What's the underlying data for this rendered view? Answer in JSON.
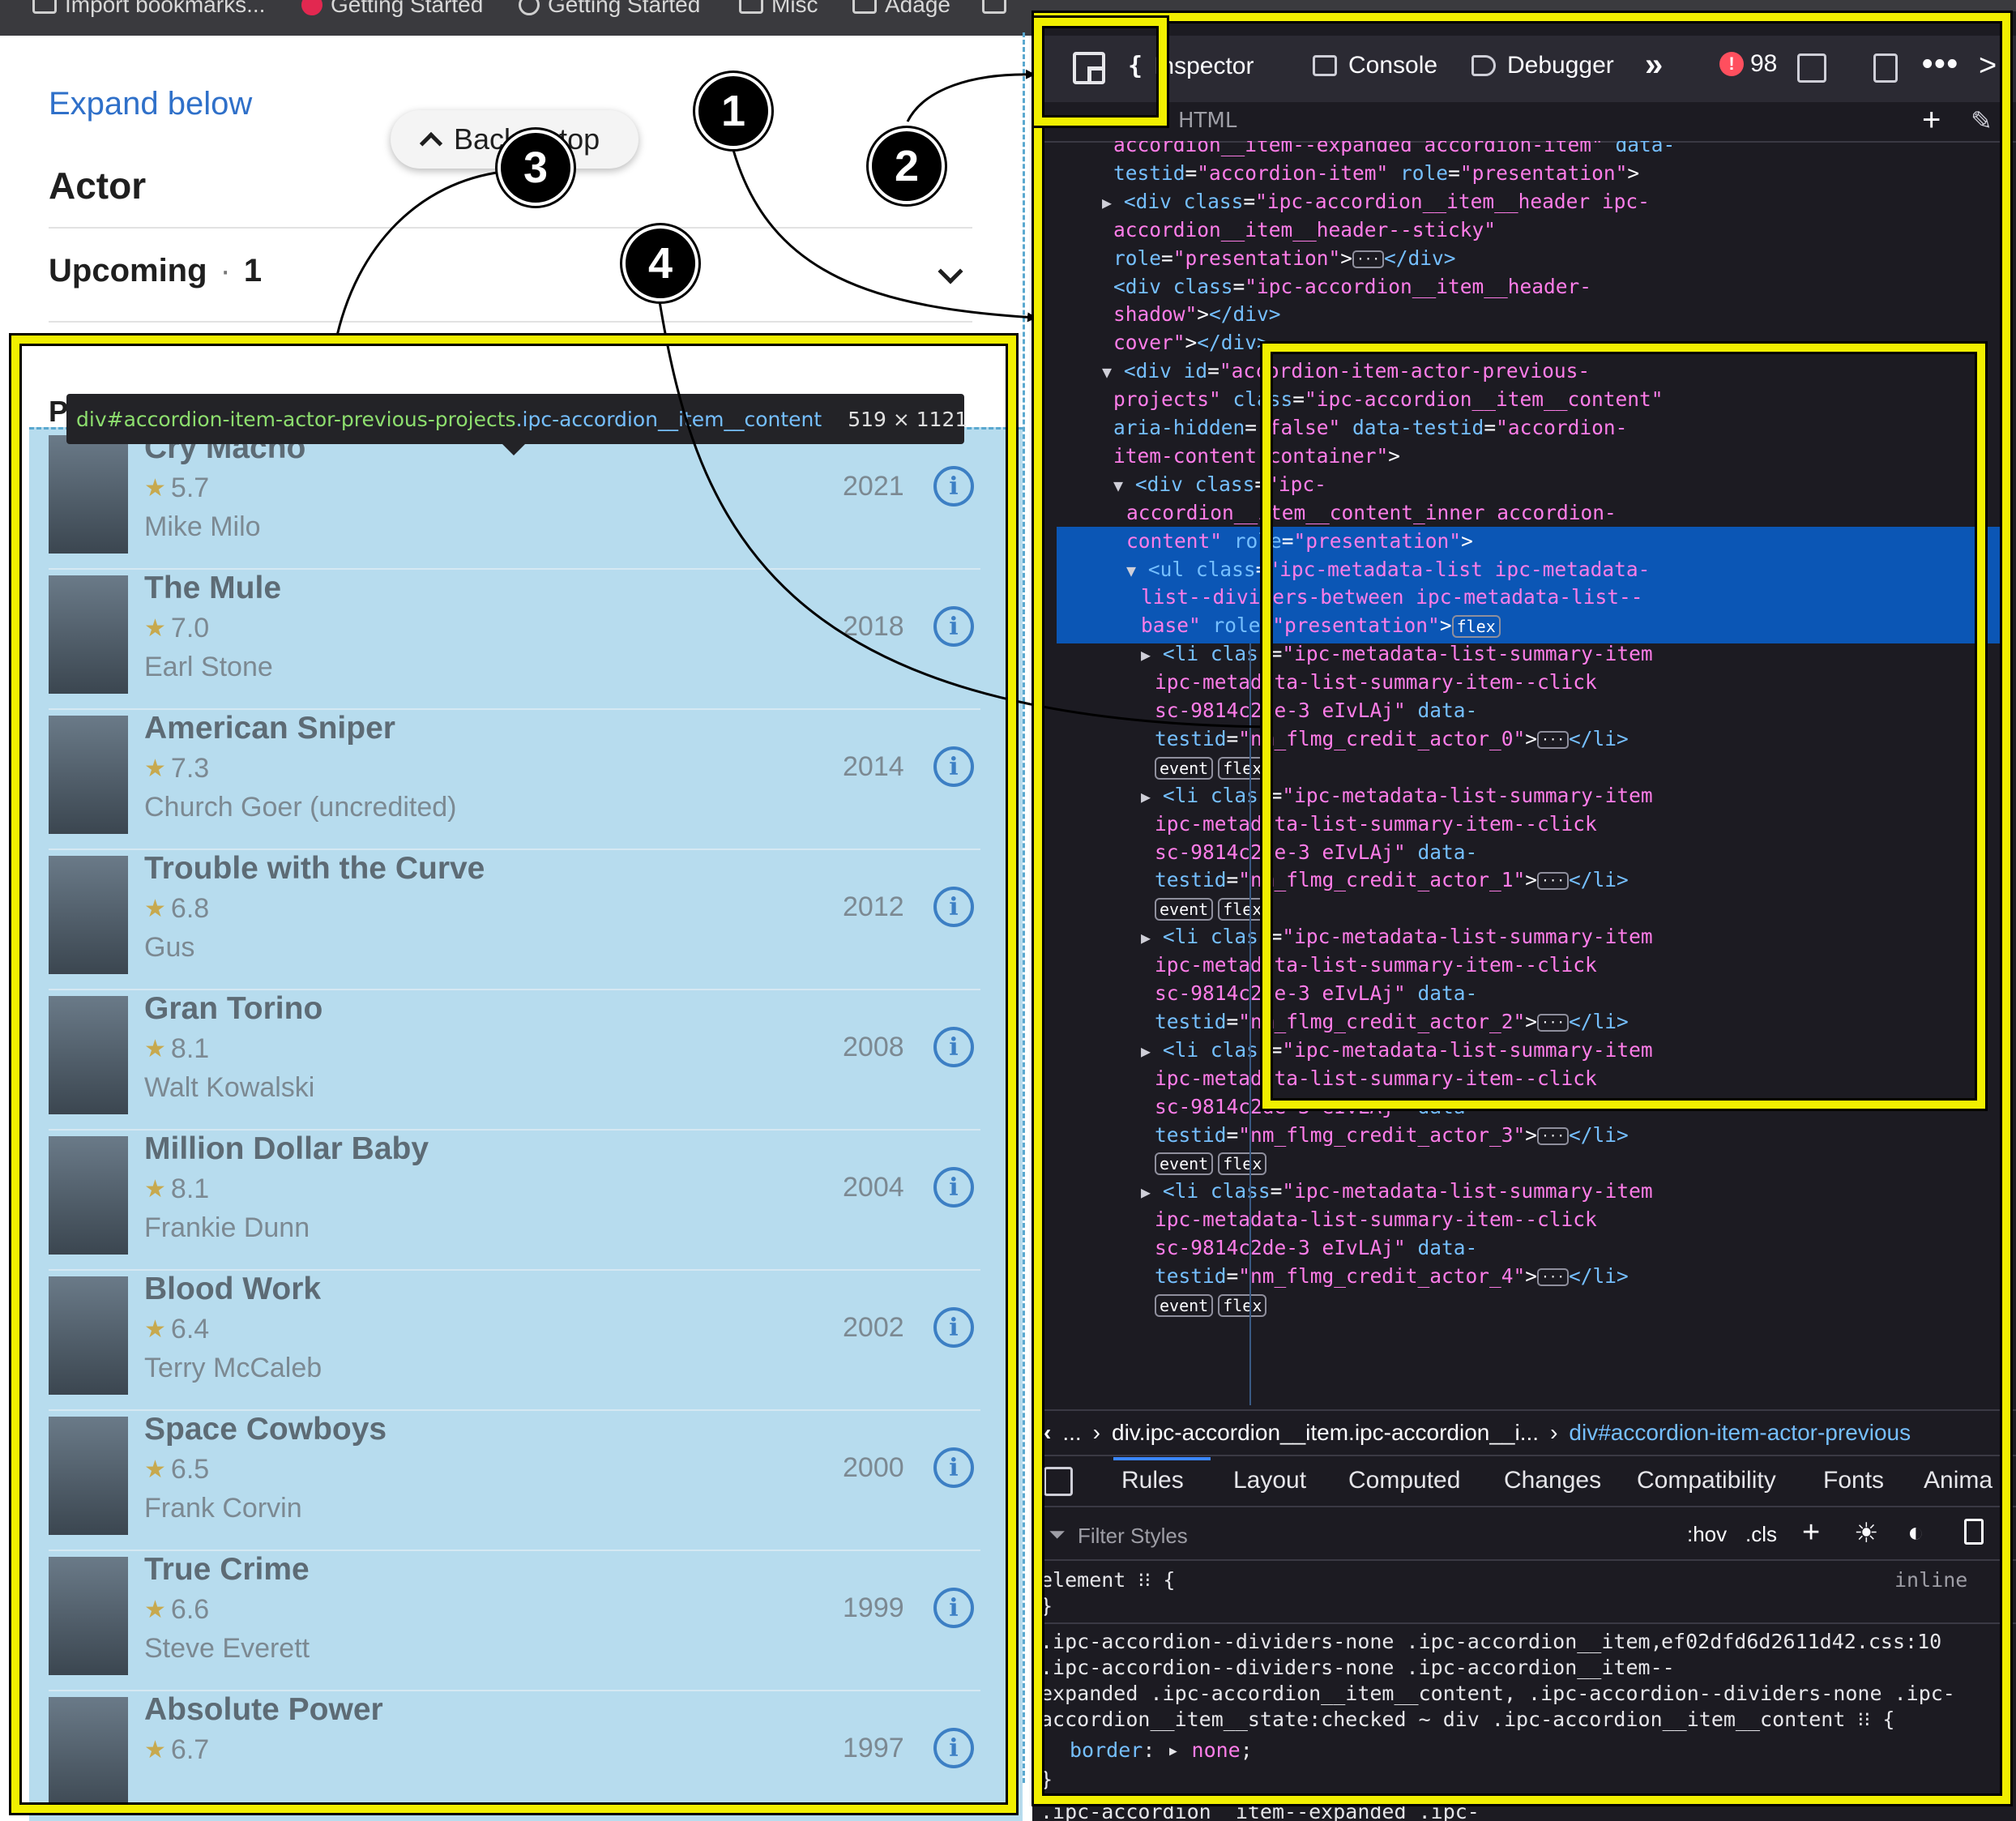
{
  "bookmarks": [
    "Import bookmarks...",
    "Getting Started",
    "Getting Started",
    "Misc",
    "Adage",
    ""
  ],
  "page": {
    "expand_link": "Expand below",
    "section_title": "Actor",
    "back_to_top": "Back to top",
    "upcoming_label": "Upcoming",
    "upcoming_dot": "·",
    "upcoming_count": "1",
    "previous_letter": "P",
    "tooltip": {
      "tag": "div",
      "selector_id": "#accordion-item-actor-previous-projects",
      "selector_class": ".ipc-accordion__item__content",
      "dims": "519 × 1121"
    },
    "movies": [
      {
        "title": "Cry Macho",
        "rating": "5.7",
        "role": "Mike Milo",
        "year": "2021"
      },
      {
        "title": "The Mule",
        "rating": "7.0",
        "role": "Earl Stone",
        "year": "2018"
      },
      {
        "title": "American Sniper",
        "rating": "7.3",
        "role": "Church Goer (uncredited)",
        "year": "2014"
      },
      {
        "title": "Trouble with the Curve",
        "rating": "6.8",
        "role": "Gus",
        "year": "2012"
      },
      {
        "title": "Gran Torino",
        "rating": "8.1",
        "role": "Walt Kowalski",
        "year": "2008"
      },
      {
        "title": "Million Dollar Baby",
        "rating": "8.1",
        "role": "Frankie Dunn",
        "year": "2004"
      },
      {
        "title": "Blood Work",
        "rating": "6.4",
        "role": "Terry McCaleb",
        "year": "2002"
      },
      {
        "title": "Space Cowboys",
        "rating": "6.5",
        "role": "Frank Corvin",
        "year": "2000"
      },
      {
        "title": "True Crime",
        "rating": "6.6",
        "role": "Steve Everett",
        "year": "1999"
      },
      {
        "title": "Absolute Power",
        "rating": "6.7",
        "role": "",
        "year": "1997"
      }
    ],
    "info_glyph": "i",
    "star_glyph": "★"
  },
  "devtools": {
    "tabs": {
      "inspector": "Inspector",
      "console": "Console",
      "debugger": "Debugger"
    },
    "error_count": "98",
    "error_glyph": "!",
    "html_label": "HTML",
    "add_glyph": "+",
    "more_glyph": "»",
    "dots_glyph": "•••",
    "chevron_right": ">",
    "code_lines": [
      {
        "ind": 0,
        "parts": [
          [
            "v",
            "accordion__item--expanded accordion-item\""
          ],
          [
            "a",
            " data-"
          ]
        ]
      },
      {
        "ind": 0,
        "parts": [
          [
            "a",
            "testid"
          ],
          [
            "p",
            "="
          ],
          [
            "v",
            "\"accordion-item\""
          ],
          [
            "a",
            " role"
          ],
          [
            "p",
            "="
          ],
          [
            "v",
            "\"presentation\""
          ],
          [
            "p",
            ">"
          ]
        ]
      },
      {
        "ind": 0,
        "tri": "▶",
        "parts": [
          [
            "t",
            "<div"
          ],
          [
            "a",
            " class"
          ],
          [
            "p",
            "="
          ],
          [
            "v",
            "\"ipc-accordion__item__header ipc-"
          ]
        ]
      },
      {
        "ind": 1,
        "parts": [
          [
            "v",
            "accordion__item__header--sticky\""
          ]
        ]
      },
      {
        "ind": 1,
        "parts": [
          [
            "a",
            "role"
          ],
          [
            "p",
            "="
          ],
          [
            "v",
            "\"presentation\""
          ],
          [
            "p",
            ">"
          ],
          [
            "ell",
            "···"
          ],
          [
            "t",
            "</div>"
          ]
        ]
      },
      {
        "ind": 1,
        "parts": [
          [
            "t",
            "<div"
          ],
          [
            "a",
            " class"
          ],
          [
            "p",
            "="
          ],
          [
            "v",
            "\"ipc-accordion__item__header-"
          ]
        ]
      },
      {
        "ind": 1,
        "parts": [
          [
            "v",
            "shadow\""
          ],
          [
            "p",
            ">"
          ],
          [
            "t",
            "</div>"
          ]
        ]
      },
      {
        "ind": 1,
        "parts": [
          [
            "v",
            "cover\""
          ],
          [
            "p",
            ">"
          ],
          [
            "t",
            "</div>"
          ]
        ]
      },
      {
        "ind": 0,
        "tri": "▼",
        "parts": [
          [
            "t",
            "<div"
          ],
          [
            "a",
            " id"
          ],
          [
            "p",
            "="
          ],
          [
            "v",
            "\"accordion-item-actor-previous-"
          ]
        ]
      },
      {
        "ind": 1,
        "parts": [
          [
            "v",
            "projects\""
          ],
          [
            "a",
            " class"
          ],
          [
            "p",
            "="
          ],
          [
            "v",
            "\"ipc-accordion__item__content\""
          ]
        ]
      },
      {
        "ind": 1,
        "parts": [
          [
            "a",
            "aria-hidden"
          ],
          [
            "p",
            "="
          ],
          [
            "v",
            "\"false\""
          ],
          [
            "a",
            " data-testid"
          ],
          [
            "p",
            "="
          ],
          [
            "v",
            "\"accordion-"
          ]
        ]
      },
      {
        "ind": 1,
        "parts": [
          [
            "v",
            "item-content-container\""
          ],
          [
            "p",
            ">"
          ]
        ]
      },
      {
        "ind": 2,
        "tri": "▼",
        "parts": [
          [
            "t",
            "<div"
          ],
          [
            "a",
            " class"
          ],
          [
            "p",
            "="
          ],
          [
            "v",
            "\"ipc-"
          ]
        ]
      },
      {
        "ind": 3,
        "parts": [
          [
            "v",
            "accordion__item__content_inner accordion-"
          ]
        ]
      },
      {
        "ind": 3,
        "parts": [
          [
            "v",
            "content\""
          ],
          [
            "a",
            " role"
          ],
          [
            "p",
            "="
          ],
          [
            "v",
            "\"presentation\""
          ],
          [
            "p",
            ">"
          ]
        ]
      },
      {
        "ind": 4,
        "tri": "▼",
        "parts": [
          [
            "t",
            "<ul"
          ],
          [
            "a",
            " class"
          ],
          [
            "p",
            "="
          ],
          [
            "v",
            "\"ipc-metadata-list ipc-metadata-"
          ]
        ]
      },
      {
        "ind": 5,
        "parts": [
          [
            "v",
            "list--dividers-between ipc-metadata-list--"
          ]
        ]
      },
      {
        "ind": 5,
        "parts": [
          [
            "v",
            "base\""
          ],
          [
            "a",
            " role"
          ],
          [
            "p",
            "="
          ],
          [
            "v",
            "\"presentation\""
          ],
          [
            "p",
            ">"
          ],
          [
            "badge",
            "flex"
          ]
        ]
      },
      {
        "ind": 6,
        "tri": "▶",
        "parts": [
          [
            "t",
            "<li"
          ],
          [
            "a",
            " class"
          ],
          [
            "p",
            "="
          ],
          [
            "v",
            "\"ipc-metadata-list-summary-item"
          ]
        ]
      },
      {
        "ind": 7,
        "parts": [
          [
            "v",
            "ipc-metadata-list-summary-item--click"
          ]
        ]
      },
      {
        "ind": 7,
        "parts": [
          [
            "v",
            "sc-9814c2de-3 eIvLAj\""
          ],
          [
            "a",
            " data-"
          ]
        ]
      },
      {
        "ind": 7,
        "parts": [
          [
            "a",
            "testid"
          ],
          [
            "p",
            "="
          ],
          [
            "v",
            "\"nm_flmg_credit_actor_0\""
          ],
          [
            "p",
            ">"
          ],
          [
            "ell",
            "···"
          ],
          [
            "t",
            "</li>"
          ]
        ]
      },
      {
        "ind": 7,
        "parts": [
          [
            "badge",
            "event"
          ],
          [
            "badge",
            "flex"
          ]
        ]
      },
      {
        "ind": 6,
        "tri": "▶",
        "parts": [
          [
            "t",
            "<li"
          ],
          [
            "a",
            " class"
          ],
          [
            "p",
            "="
          ],
          [
            "v",
            "\"ipc-metadata-list-summary-item"
          ]
        ]
      },
      {
        "ind": 7,
        "parts": [
          [
            "v",
            "ipc-metadata-list-summary-item--click"
          ]
        ]
      },
      {
        "ind": 7,
        "parts": [
          [
            "v",
            "sc-9814c2de-3 eIvLAj\""
          ],
          [
            "a",
            " data-"
          ]
        ]
      },
      {
        "ind": 7,
        "parts": [
          [
            "a",
            "testid"
          ],
          [
            "p",
            "="
          ],
          [
            "v",
            "\"nm_flmg_credit_actor_1\""
          ],
          [
            "p",
            ">"
          ],
          [
            "ell",
            "···"
          ],
          [
            "t",
            "</li>"
          ]
        ]
      },
      {
        "ind": 7,
        "parts": [
          [
            "badge",
            "event"
          ],
          [
            "badge",
            "flex"
          ]
        ]
      },
      {
        "ind": 6,
        "tri": "▶",
        "parts": [
          [
            "t",
            "<li"
          ],
          [
            "a",
            " class"
          ],
          [
            "p",
            "="
          ],
          [
            "v",
            "\"ipc-metadata-list-summary-item"
          ]
        ]
      },
      {
        "ind": 7,
        "parts": [
          [
            "v",
            "ipc-metadata-list-summary-item--click"
          ]
        ]
      },
      {
        "ind": 7,
        "parts": [
          [
            "v",
            "sc-9814c2de-3 eIvLAj\""
          ],
          [
            "a",
            " data-"
          ]
        ]
      },
      {
        "ind": 7,
        "parts": [
          [
            "a",
            "testid"
          ],
          [
            "p",
            "="
          ],
          [
            "v",
            "\"nm_flmg_credit_actor_2\""
          ],
          [
            "p",
            ">"
          ],
          [
            "ell",
            "···"
          ],
          [
            "t",
            "</li>"
          ]
        ]
      },
      {
        "ind": 6,
        "tri": "▶",
        "parts": [
          [
            "t",
            "<li"
          ],
          [
            "a",
            " class"
          ],
          [
            "p",
            "="
          ],
          [
            "v",
            "\"ipc-metadata-list-summary-item"
          ]
        ]
      },
      {
        "ind": 7,
        "parts": [
          [
            "v",
            "ipc-metadata-list-summary-item--click"
          ]
        ]
      },
      {
        "ind": 7,
        "parts": [
          [
            "v",
            "sc-9814c2de-3 eIvLAj\""
          ],
          [
            "a",
            " data-"
          ]
        ]
      },
      {
        "ind": 7,
        "parts": [
          [
            "a",
            "testid"
          ],
          [
            "p",
            "="
          ],
          [
            "v",
            "\"nm_flmg_credit_actor_3\""
          ],
          [
            "p",
            ">"
          ],
          [
            "ell",
            "···"
          ],
          [
            "t",
            "</li>"
          ]
        ]
      },
      {
        "ind": 7,
        "parts": [
          [
            "badge",
            "event"
          ],
          [
            "badge",
            "flex"
          ]
        ]
      },
      {
        "ind": 6,
        "tri": "▶",
        "parts": [
          [
            "t",
            "<li"
          ],
          [
            "a",
            " class"
          ],
          [
            "p",
            "="
          ],
          [
            "v",
            "\"ipc-metadata-list-summary-item"
          ]
        ]
      },
      {
        "ind": 7,
        "parts": [
          [
            "v",
            "ipc-metadata-list-summary-item--click"
          ]
        ]
      },
      {
        "ind": 7,
        "parts": [
          [
            "v",
            "sc-9814c2de-3 eIvLAj\""
          ],
          [
            "a",
            " data-"
          ]
        ]
      },
      {
        "ind": 7,
        "parts": [
          [
            "a",
            "testid"
          ],
          [
            "p",
            "="
          ],
          [
            "v",
            "\"nm_flmg_credit_actor_4\""
          ],
          [
            "p",
            ">"
          ],
          [
            "ell",
            "···"
          ],
          [
            "t",
            "</li>"
          ]
        ]
      },
      {
        "ind": 7,
        "parts": [
          [
            "badge",
            "event"
          ],
          [
            "badge",
            "flex"
          ]
        ]
      }
    ],
    "breadcrumbs": [
      "...",
      "div.ipc-accordion__item.ipc-accordion__i...",
      "div#accordion-item-actor-previous"
    ],
    "panel_tabs": [
      "Rules",
      "Layout",
      "Computed",
      "Changes",
      "Compatibility",
      "Fonts",
      "Anima"
    ],
    "filter_placeholder": "Filter Styles",
    "hov": ":hov",
    "cls": ".cls",
    "rules": {
      "element_line": "element ⁝⁝ {",
      "inline": "inline",
      "close": "}",
      "selector_lines": [
        ".ipc-accordion--dividers-none .ipc-accordion__item,",
        ".ipc-accordion--dividers-none .ipc-accordion__item--",
        "expanded .ipc-accordion__item__content, .ipc-accordion--dividers-none .ipc-",
        "accordion__item__state:checked ~ div .ipc-accordion__item__content ⁝⁝ {"
      ],
      "source": "ef02dfd6d2611d42.css:10",
      "prop": "border",
      "value": "none",
      "bottom_line": ".ipc-accordion__item--expanded .ipc-"
    }
  },
  "annotations": [
    "1",
    "2",
    "3",
    "4"
  ],
  "colors": {
    "highlight": "#f1ef00",
    "selection": "#0b56b5"
  }
}
